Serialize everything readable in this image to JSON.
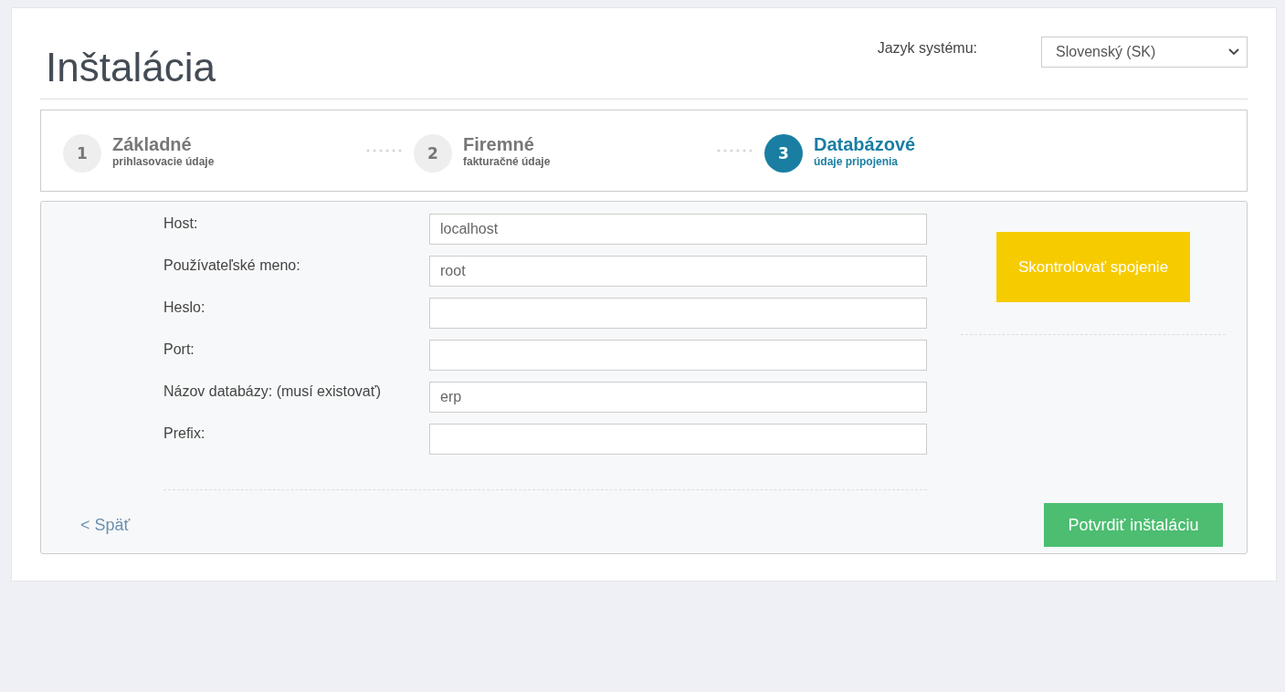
{
  "title": "Inštalácia",
  "language": {
    "label": "Jazyk systému:",
    "value": "Slovenský (SK)"
  },
  "steps": [
    {
      "number": "1",
      "title": "Základné",
      "subtitle": "prihlasovacie údaje",
      "selected": false
    },
    {
      "number": "2",
      "title": "Firemné",
      "subtitle": "fakturačné údaje",
      "selected": false
    },
    {
      "number": "3",
      "title": "Databázové",
      "subtitle": "údaje pripojenia",
      "selected": true
    }
  ],
  "fields": [
    {
      "label": "Host:",
      "value": "localhost"
    },
    {
      "label": "Používateľské meno:",
      "value": "root"
    },
    {
      "label": "Heslo:"
    },
    {
      "label": "Port:"
    },
    {
      "label": "Názov databázy: (musí existovať)",
      "value": "erp"
    },
    {
      "label": "Prefix:"
    }
  ],
  "check_button": "Skontrolovať spojenie",
  "back_link": "< Späť",
  "confirm_button": "Potvrdiť inštaláciu"
}
